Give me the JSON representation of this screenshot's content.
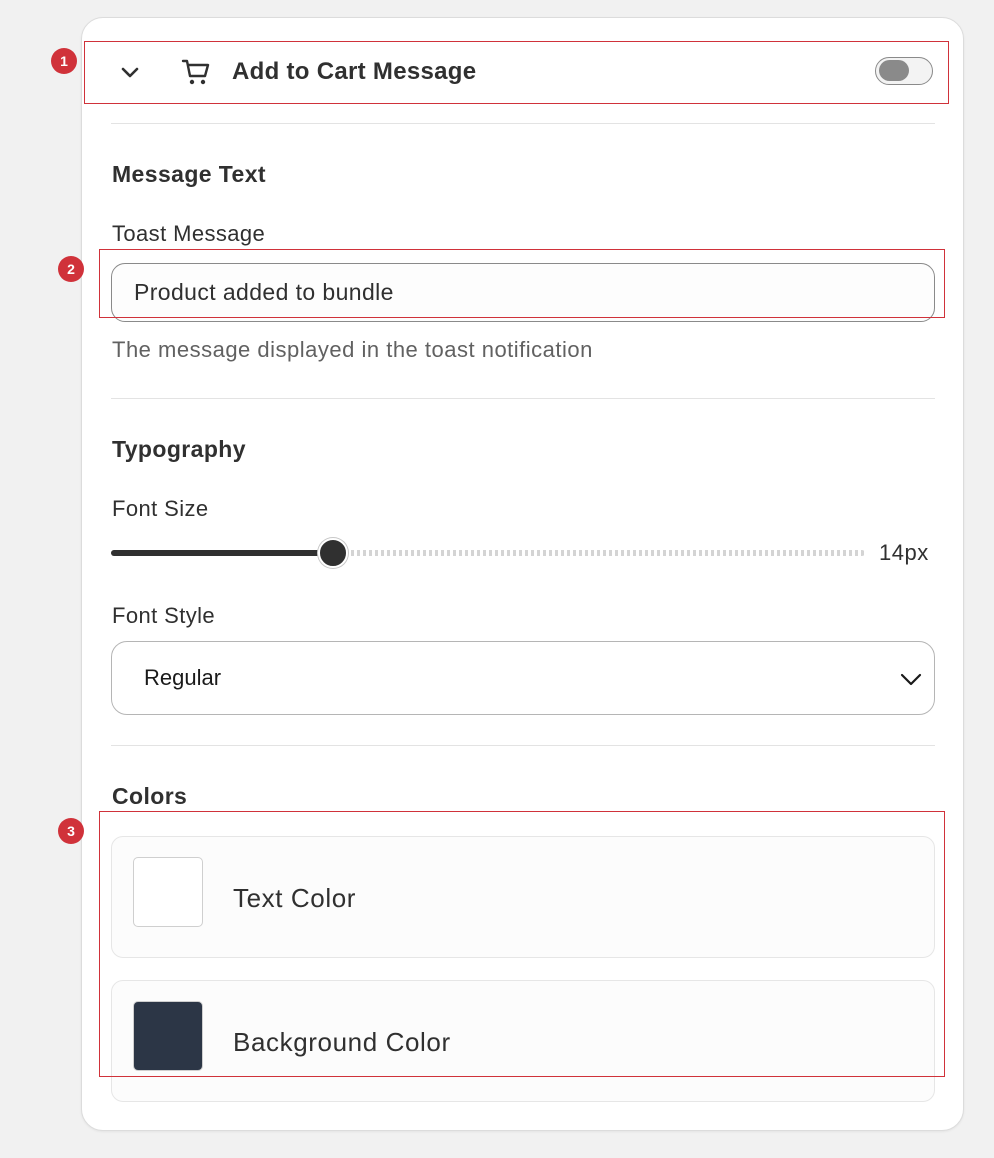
{
  "panel": {
    "title": "Add to Cart Message",
    "icon": "cart-icon",
    "collapse_icon": "chevron-down-icon",
    "enabled": false
  },
  "message_text": {
    "heading": "Message Text",
    "toast_label": "Toast Message",
    "toast_value": "Product added to bundle",
    "help": "The message displayed in the toast notification"
  },
  "typography": {
    "heading": "Typography",
    "font_size_label": "Font Size",
    "font_size_value": "14px",
    "font_size_fraction": 0.295,
    "font_style_label": "Font Style",
    "font_style_value": "Regular"
  },
  "colors": {
    "heading": "Colors",
    "items": [
      {
        "label": "Text Color",
        "value": "#ffffff"
      },
      {
        "label": "Background Color",
        "value": "#2c3646"
      }
    ]
  },
  "annotations": [
    "1",
    "2",
    "3"
  ],
  "theme": {
    "annotation": "#d0323a",
    "slider_fill": "#303030"
  }
}
